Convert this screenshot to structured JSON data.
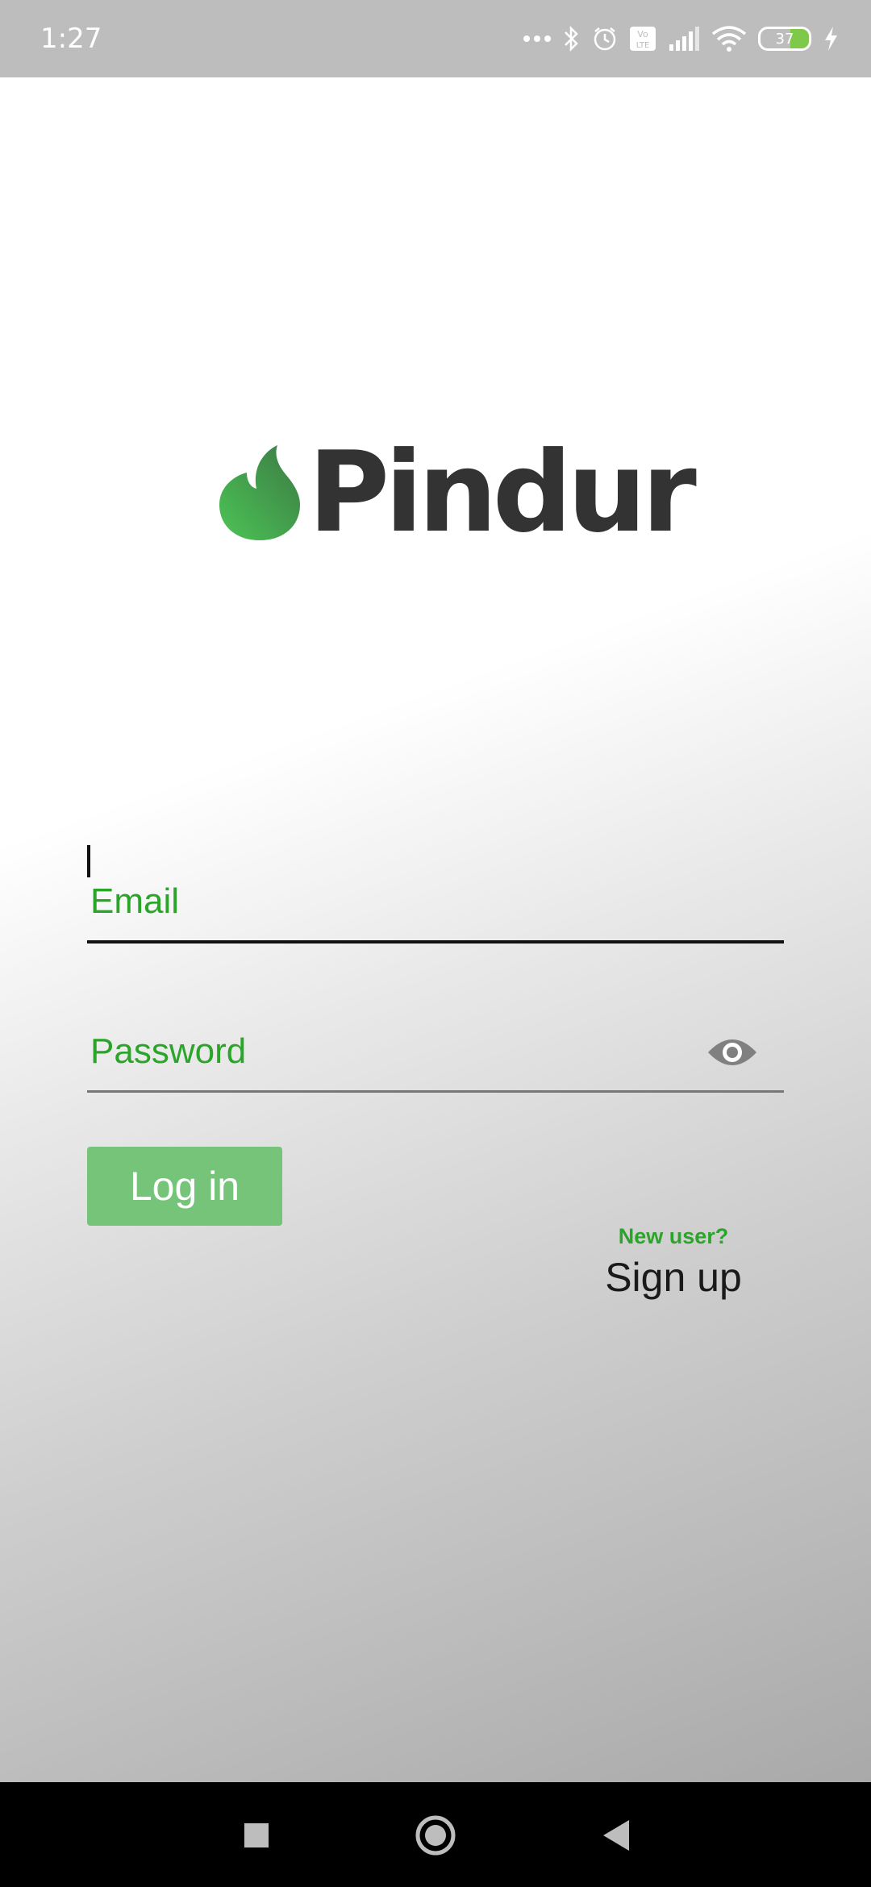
{
  "status_bar": {
    "time": "1:27",
    "battery_level": "37",
    "icons": [
      "more-dots-icon",
      "bluetooth-icon",
      "alarm-icon",
      "volte-icon",
      "signal-icon",
      "wifi-icon",
      "battery-icon",
      "charging-icon"
    ],
    "volte_label": "Vo\nLTE"
  },
  "logo": {
    "text": "Pindur",
    "flame_color": "#4cbf55"
  },
  "form": {
    "email_placeholder": "Email",
    "password_placeholder": "Password",
    "login_label": "Log in",
    "new_user_label": "New user?",
    "signup_label": "Sign up"
  },
  "nav_bar": {
    "icons": [
      "recent-apps-icon",
      "home-icon",
      "back-icon"
    ]
  },
  "colors": {
    "accent": "#2aa52a",
    "button": "#76c47a",
    "status_bar": "#bdbdbd"
  }
}
